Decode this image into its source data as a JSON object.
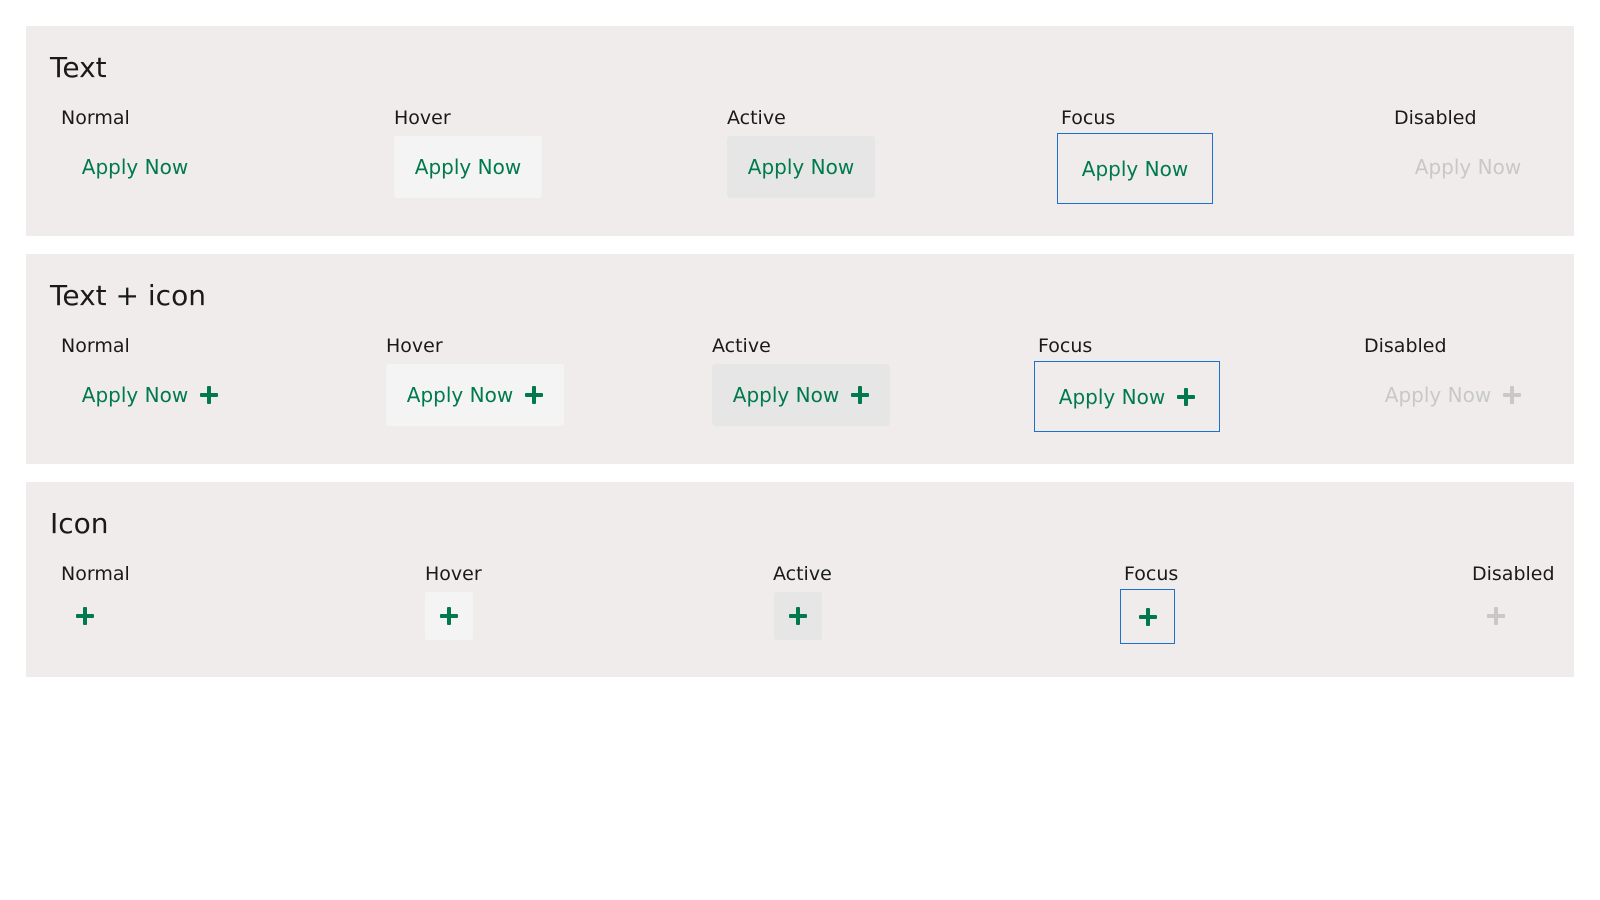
{
  "sections": [
    {
      "title": "Text",
      "states": [
        {
          "label": "Normal",
          "button": "Apply Now"
        },
        {
          "label": "Hover",
          "button": "Apply Now"
        },
        {
          "label": "Active",
          "button": "Apply Now"
        },
        {
          "label": "Focus",
          "button": "Apply Now"
        },
        {
          "label": "Disabled",
          "button": "Apply Now"
        }
      ]
    },
    {
      "title": "Text + icon",
      "states": [
        {
          "label": "Normal",
          "button": "Apply Now",
          "icon": "plus-icon"
        },
        {
          "label": "Hover",
          "button": "Apply Now",
          "icon": "plus-icon"
        },
        {
          "label": "Active",
          "button": "Apply Now",
          "icon": "plus-icon"
        },
        {
          "label": "Focus",
          "button": "Apply Now",
          "icon": "plus-icon"
        },
        {
          "label": "Disabled",
          "button": "Apply Now",
          "icon": "plus-icon"
        }
      ]
    },
    {
      "title": "Icon",
      "states": [
        {
          "label": "Normal",
          "icon": "plus-icon"
        },
        {
          "label": "Hover",
          "icon": "plus-icon"
        },
        {
          "label": "Active",
          "icon": "plus-icon"
        },
        {
          "label": "Focus",
          "icon": "plus-icon"
        },
        {
          "label": "Disabled",
          "icon": "plus-icon"
        }
      ]
    }
  ],
  "colors": {
    "primary_text": "#007a4d",
    "disabled_text": "#c8c8c8",
    "hover_bg": "#f4f4f4",
    "active_bg": "#e6e6e6",
    "focus_border": "#1f6fd0",
    "panel_bg": "#f0ecec"
  }
}
